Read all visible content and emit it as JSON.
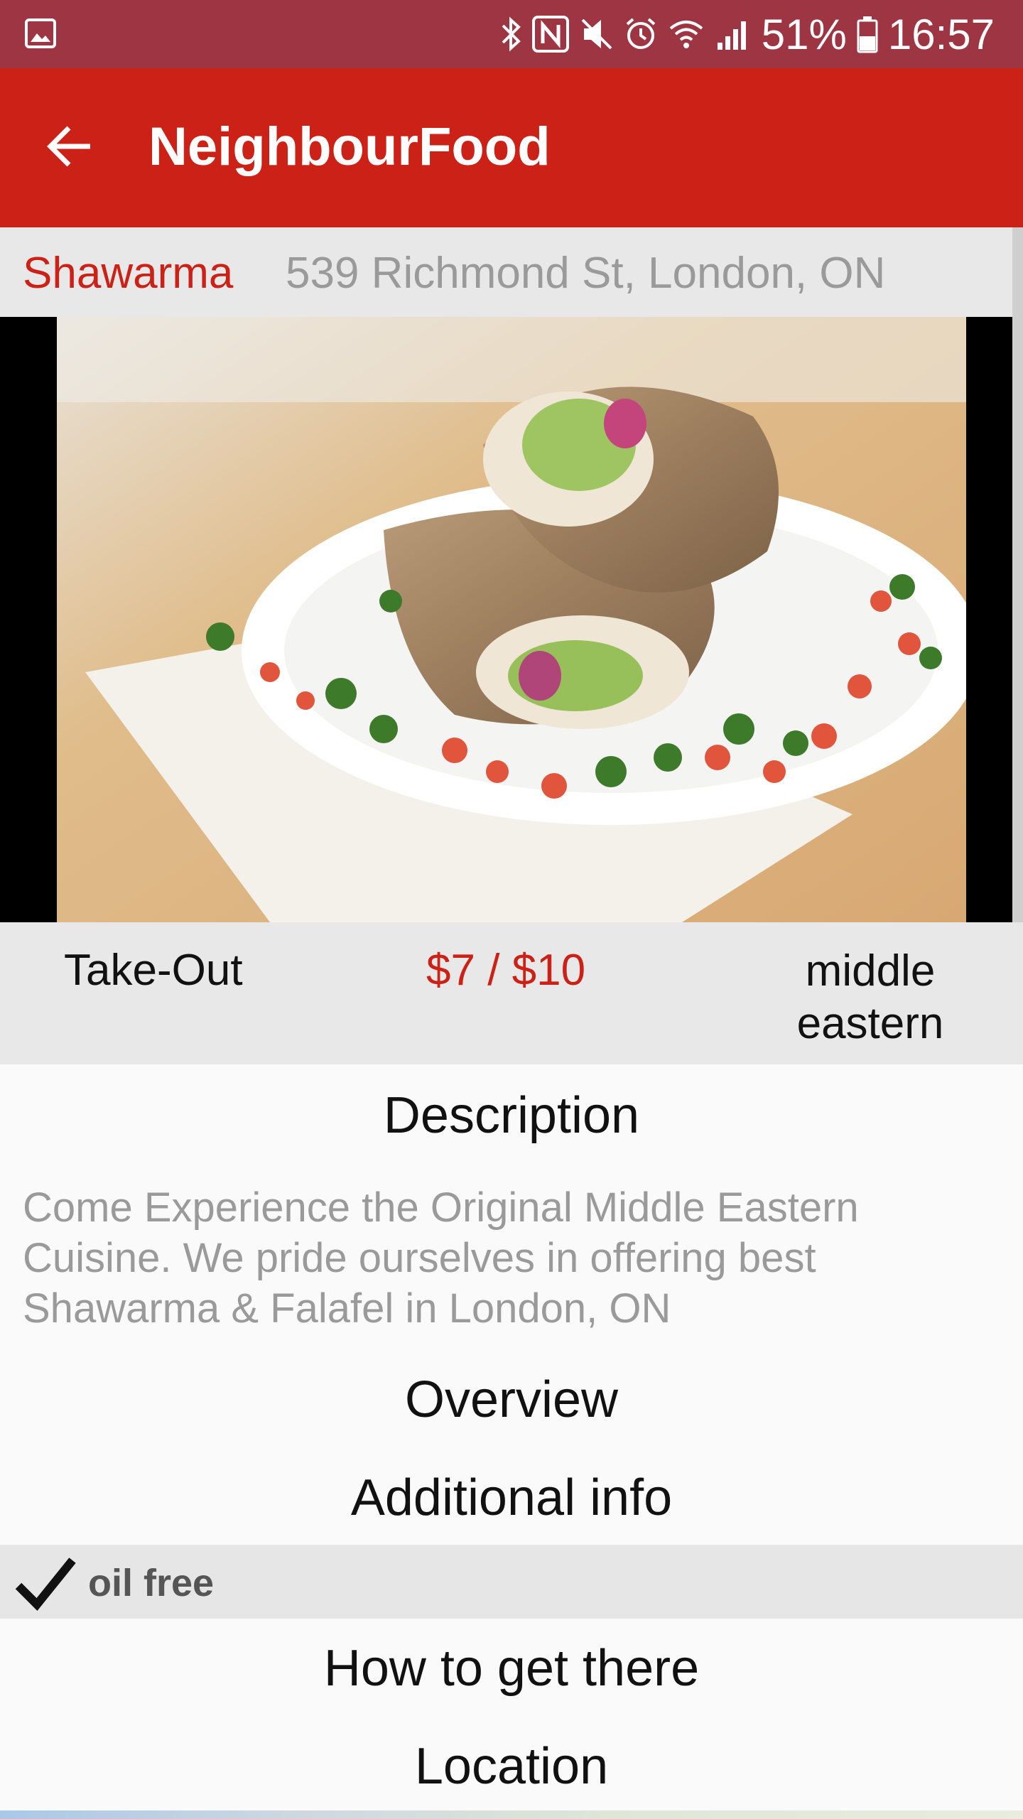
{
  "status_bar": {
    "battery": "51%",
    "time": "16:57",
    "icons": [
      "gallery-icon",
      "bluetooth-icon",
      "nfc-icon",
      "mute-icon",
      "alarm-icon",
      "wifi-icon",
      "signal-icon",
      "battery-icon"
    ]
  },
  "app_bar": {
    "title": "NeighbourFood",
    "back_icon": "arrow-back-icon"
  },
  "dish": {
    "name": "Shawarma",
    "address": "539 Richmond St, London, ON",
    "service_type": "Take-Out",
    "price": "$7 / $10",
    "cuisine": "middle eastern"
  },
  "sections": {
    "description_title": "Description",
    "description_text": "Come Experience the Original Middle Eastern Cuisine. We pride ourselves in offering best Shawarma & Falafel in London, ON",
    "overview_title": "Overview",
    "additional_info_title": "Additional info",
    "how_to_get_there_title": "How to get there",
    "location_title": "Location"
  },
  "features": [
    {
      "label": "oil free",
      "checked": true
    }
  ],
  "colors": {
    "status_bar": "#9e3543",
    "app_bar": "#cc2117",
    "accent_text": "#cc2117",
    "header_bg": "#e8e8e8"
  }
}
